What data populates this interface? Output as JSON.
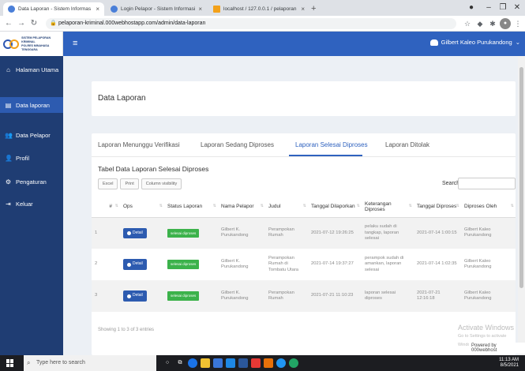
{
  "browser": {
    "tabs": [
      {
        "title": "Data Laporan - Sistem Informas",
        "active": true,
        "color": "#4a7fd8"
      },
      {
        "title": "Login Pelapor - Sistem Informasi",
        "active": false,
        "color": "#4a7fd8"
      },
      {
        "title": "localhost / 127.0.0.1 / pelaporan",
        "active": false,
        "color": "#f3a11a"
      }
    ],
    "url": "pelaporan-kriminal.000webhostapp.com/admin/data-laporan"
  },
  "brand": {
    "line1": "SISTEM PELAPORAN KRIMINAL",
    "line2": "POLRES MINAHASA TENGGARA"
  },
  "sidebar": {
    "items": [
      {
        "label": "Halaman Utama",
        "icon": "home-icon",
        "glyph": "⌂"
      },
      {
        "label": "Data laporan",
        "icon": "list-icon",
        "glyph": "▤"
      },
      {
        "label": "Data Pelapor",
        "icon": "users-icon",
        "glyph": "👥"
      },
      {
        "label": "Profil",
        "icon": "user-icon",
        "glyph": "👤"
      },
      {
        "label": "Pengaturan",
        "icon": "gears-icon",
        "glyph": "⚙"
      },
      {
        "label": "Keluar",
        "icon": "logout-icon",
        "glyph": "⇥"
      }
    ]
  },
  "topnav": {
    "user": "Gilbert Kaleo Purukandong"
  },
  "page": {
    "title": "Data Laporan"
  },
  "tabs": [
    "Laporan Menunggu Verifikasi",
    "Laporan Sedang Diproses",
    "Laporan Selesai Diproses",
    "Laporan Ditolak"
  ],
  "table": {
    "title": "Tabel Data Laporan Selesai Diproses",
    "buttons": [
      "Excel",
      "Print",
      "Column visibility"
    ],
    "search_label": "Search:",
    "columns": [
      "#",
      "Ops",
      "Status Laporan",
      "Nama Pelapor",
      "Judul",
      "Tanggal Dilaporkan",
      "Keterangan Diproses",
      "Tanggal Diproses",
      "Diproses Oleh"
    ],
    "detail_label": "Detail",
    "rows": [
      {
        "no": "1",
        "status": "selesai diproses",
        "nama": "Gilbert K. Purukandong",
        "judul": "Perampokan Rumah",
        "tanggal": "2021-07-12 19:26:25",
        "keterangan": "pelaku sudah di tangkap, laporan selesai",
        "tgl_proses": "2021-07-14 1:00:15",
        "oleh": "Gilbert Kaleo Purukandong"
      },
      {
        "no": "2",
        "status": "selesai diproses",
        "nama": "Gilbert K. Purukandong",
        "judul": "Perampokan Rumah di Tombatu Utara",
        "tanggal": "2021-07-14 19:37:27",
        "keterangan": "perampok sudah di amankan, laporan selesai",
        "tgl_proses": "2021-07-14 1:02:35",
        "oleh": "Gilbert Kaleo Purukandong"
      },
      {
        "no": "3",
        "status": "selesai diproses",
        "nama": "Gilbert K. Purukandong",
        "judul": "Perampokan Rumah",
        "tanggal": "2021-07-21 11:10:23",
        "keterangan": "laporan selesai diproses",
        "tgl_proses": "2021-07-21 12:16:18",
        "oleh": "Gilbert Kaleo Purukandong"
      }
    ],
    "info": "Showing 1 to 3 of 3 entries"
  },
  "watermark": {
    "line1": "Activate Windows",
    "line2": "Go to Settings to activate Windows."
  },
  "powered": "Powered by 000webhost",
  "taskbar": {
    "search_placeholder": "Type here to search",
    "time": "11:13 AM",
    "date": "8/5/2021"
  },
  "colors": {
    "sidebar": "#1f3d73",
    "topnav": "#2f62bf",
    "accent": "#2d5bb0",
    "badge": "#3cb24b"
  }
}
